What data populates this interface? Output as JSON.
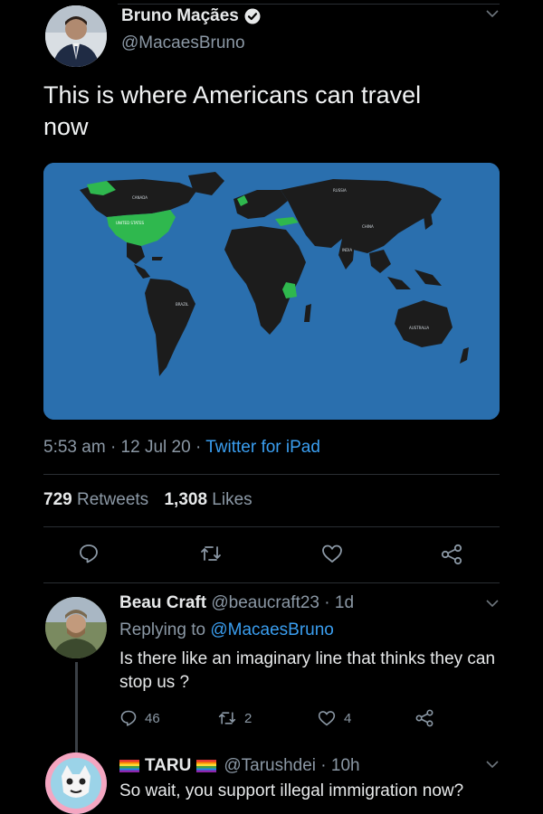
{
  "tweet": {
    "author_name": "Bruno Maçães",
    "author_handle": "@MacaesBruno",
    "text": "This is where Americans can travel now",
    "map_labels": {
      "canada": "CANADA",
      "united_states": "UNITED STATES",
      "brazil": "BRAZIL",
      "russia": "RUSSIA",
      "china": "CHINA",
      "india": "INDIA",
      "australia": "AUSTRALIA"
    },
    "time": "5:53 am",
    "date": "12 Jul 20",
    "source": "Twitter for iPad",
    "retweets_count": "729",
    "retweets_label": "Retweets",
    "likes_count": "1,308",
    "likes_label": "Likes"
  },
  "replies": [
    {
      "name": "Beau Craft",
      "handle": "@beaucraft23",
      "age": "1d",
      "replying_prefix": "Replying to",
      "replying_to": "@MacaesBruno",
      "text": "Is there like an imaginary line that thinks they can stop us ?",
      "reply_count": "46",
      "retweet_count": "2",
      "like_count": "4"
    },
    {
      "name": "TARU",
      "handle": "@Tarushdei",
      "age": "10h",
      "text": "So wait, you support illegal immigration now?"
    }
  ],
  "colors": {
    "background": "#000000",
    "text": "#e7e9ea",
    "muted": "#8b98a5",
    "link": "#3a9ef0",
    "ocean": "#2a6fae",
    "land": "#1c1c1c",
    "allowed": "#2fb84e"
  }
}
